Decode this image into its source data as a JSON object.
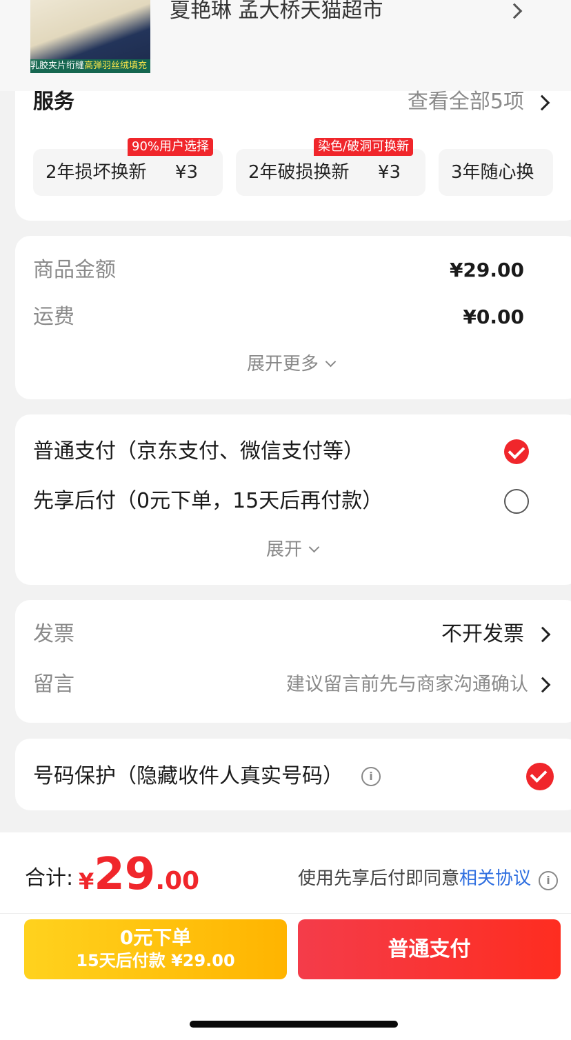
{
  "product": {
    "image_caption_part1": "乳胶夹片绗缝",
    "image_caption_part2": "高弹羽丝绒填充",
    "shop_line": "夏艳琳  孟大桥天猫超市"
  },
  "services": {
    "title": "服务",
    "view_all": "查看全部5项",
    "items": [
      {
        "name": "2年损坏换新",
        "price": "¥3",
        "badge": "90%用户选择"
      },
      {
        "name": "2年破损换新",
        "price": "¥3",
        "badge": "染色/破洞可换新"
      },
      {
        "name": "3年随心换",
        "price": "",
        "badge": ""
      }
    ]
  },
  "amounts": {
    "goods_label": "商品金额",
    "goods_value": "¥29.00",
    "shipping_label": "运费",
    "shipping_value": "¥0.00",
    "expand_more": "展开更多"
  },
  "payment": {
    "normal": "普通支付（京东支付、微信支付等）",
    "later": "先享后付（0元下单，15天后再付款）",
    "expand": "展开",
    "normal_selected": true,
    "later_selected": false
  },
  "invoice": {
    "label": "发票",
    "value": "不开发票",
    "memo_label": "留言",
    "memo_placeholder": "建议留言前先与商家沟通确认"
  },
  "privacy": {
    "label": "号码保护（隐藏收件人真实号码）",
    "checked": true
  },
  "footer": {
    "total_label": "合计:",
    "currency": "¥",
    "total_int": "29",
    "total_dec": ".00",
    "agree_text": "使用先享后付即同意",
    "agree_link": "相关协议",
    "btn_later_line1": "0元下单",
    "btn_later_line2": "15天后付款 ¥29.00",
    "btn_pay": "普通支付"
  },
  "colors": {
    "accent_red": "#f0262b",
    "link_blue": "#2f6fe0",
    "btn_yellow": "#ffc30f"
  }
}
